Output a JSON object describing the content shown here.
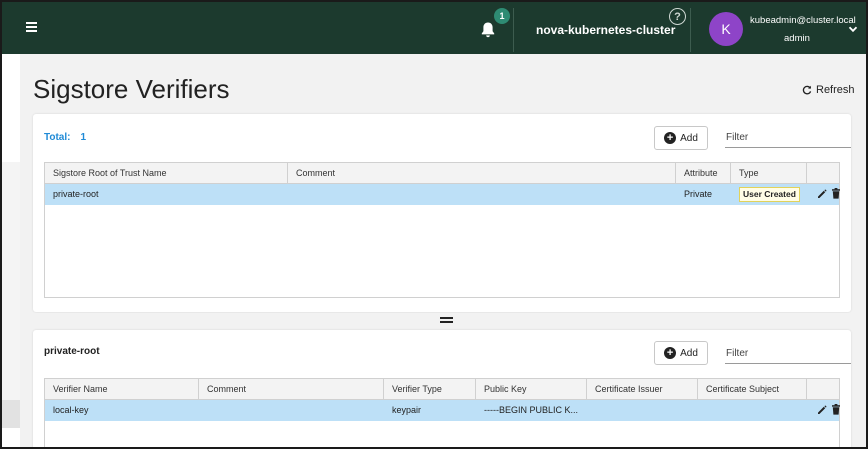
{
  "topbar": {
    "notification_count": "1",
    "cluster_name": "nova-kubernetes-cluster",
    "help_glyph": "?",
    "user": {
      "avatar_initial": "K",
      "email": "kubeadmin@cluster.local",
      "role": "admin"
    }
  },
  "page": {
    "title": "Sigstore Verifiers",
    "refresh_label": "Refresh"
  },
  "roots_panel": {
    "total_label": "Total:",
    "total_value": "1",
    "add_label": "Add",
    "filter_placeholder": "Filter",
    "columns": [
      "Sigstore Root of Trust Name",
      "Comment",
      "Attribute",
      "Type",
      ""
    ],
    "rows": [
      {
        "name": "private-root",
        "comment": "",
        "attribute": "Private",
        "type": "User Created",
        "selected": true
      }
    ]
  },
  "verifiers_panel": {
    "title": "private-root",
    "add_label": "Add",
    "filter_placeholder": "Filter",
    "columns": [
      "Verifier Name",
      "Comment",
      "Verifier Type",
      "Public Key",
      "Certificate Issuer",
      "Certificate Subject",
      ""
    ],
    "rows": [
      {
        "name": "local-key",
        "comment": "",
        "type": "keypair",
        "public_key": "-----BEGIN PUBLIC K...",
        "issuer": "",
        "subject": "",
        "selected": true
      }
    ]
  },
  "icons": {
    "menu": "hamburger-menu-icon",
    "bell": "bell-icon",
    "help": "help-icon",
    "chevron": "chevron-down-icon",
    "refresh": "refresh-icon",
    "add": "plus-circle-icon",
    "edit": "pencil-icon",
    "delete": "trash-icon",
    "splitter": "drag-handle-icon"
  },
  "colors": {
    "topbar_bg": "#1c3a2e",
    "badge_bg": "#2e8b73",
    "avatar_bg": "#8e44c8",
    "total_text": "#1f8ad6",
    "selected_row": "#bde0f7",
    "user_created_border": "#e2d25a"
  }
}
